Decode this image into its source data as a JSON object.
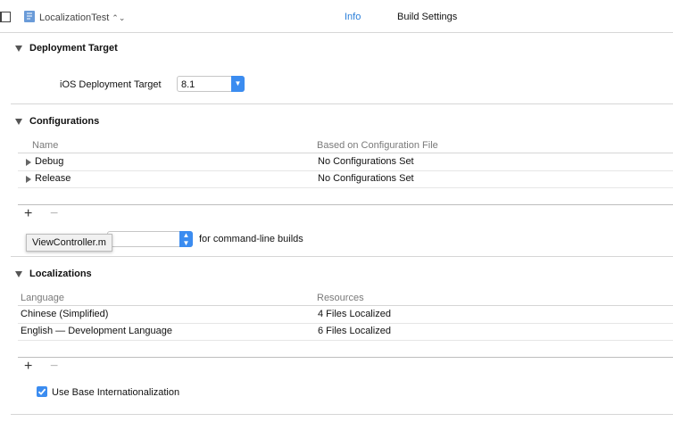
{
  "header": {
    "project_name": "LocalizationTest",
    "tabs": [
      "Info",
      "Build Settings"
    ]
  },
  "deployment": {
    "title": "Deployment Target",
    "label": "iOS Deployment Target",
    "value": "8.1"
  },
  "configurations": {
    "title": "Configurations",
    "columns": [
      "Name",
      "Based on Configuration File"
    ],
    "rows": [
      {
        "name": "Debug",
        "file": "No Configurations Set"
      },
      {
        "name": "Release",
        "file": "No Configurations Set"
      }
    ],
    "add_label": "+",
    "remove_label": "−",
    "cmdline_suffix": "for command-line builds",
    "tooltip": "ViewController.m"
  },
  "localizations": {
    "title": "Localizations",
    "columns": [
      "Language",
      "Resources"
    ],
    "rows": [
      {
        "language": "Chinese (Simplified)",
        "resources": "4 Files Localized"
      },
      {
        "language": "English — Development Language",
        "resources": "6 Files Localized"
      }
    ],
    "add_label": "+",
    "remove_label": "−",
    "base_i18n_label": "Use Base Internationalization",
    "base_i18n_checked": true
  },
  "colors": {
    "accent": "#2b7fd9",
    "separator": "#d6d6d6"
  }
}
